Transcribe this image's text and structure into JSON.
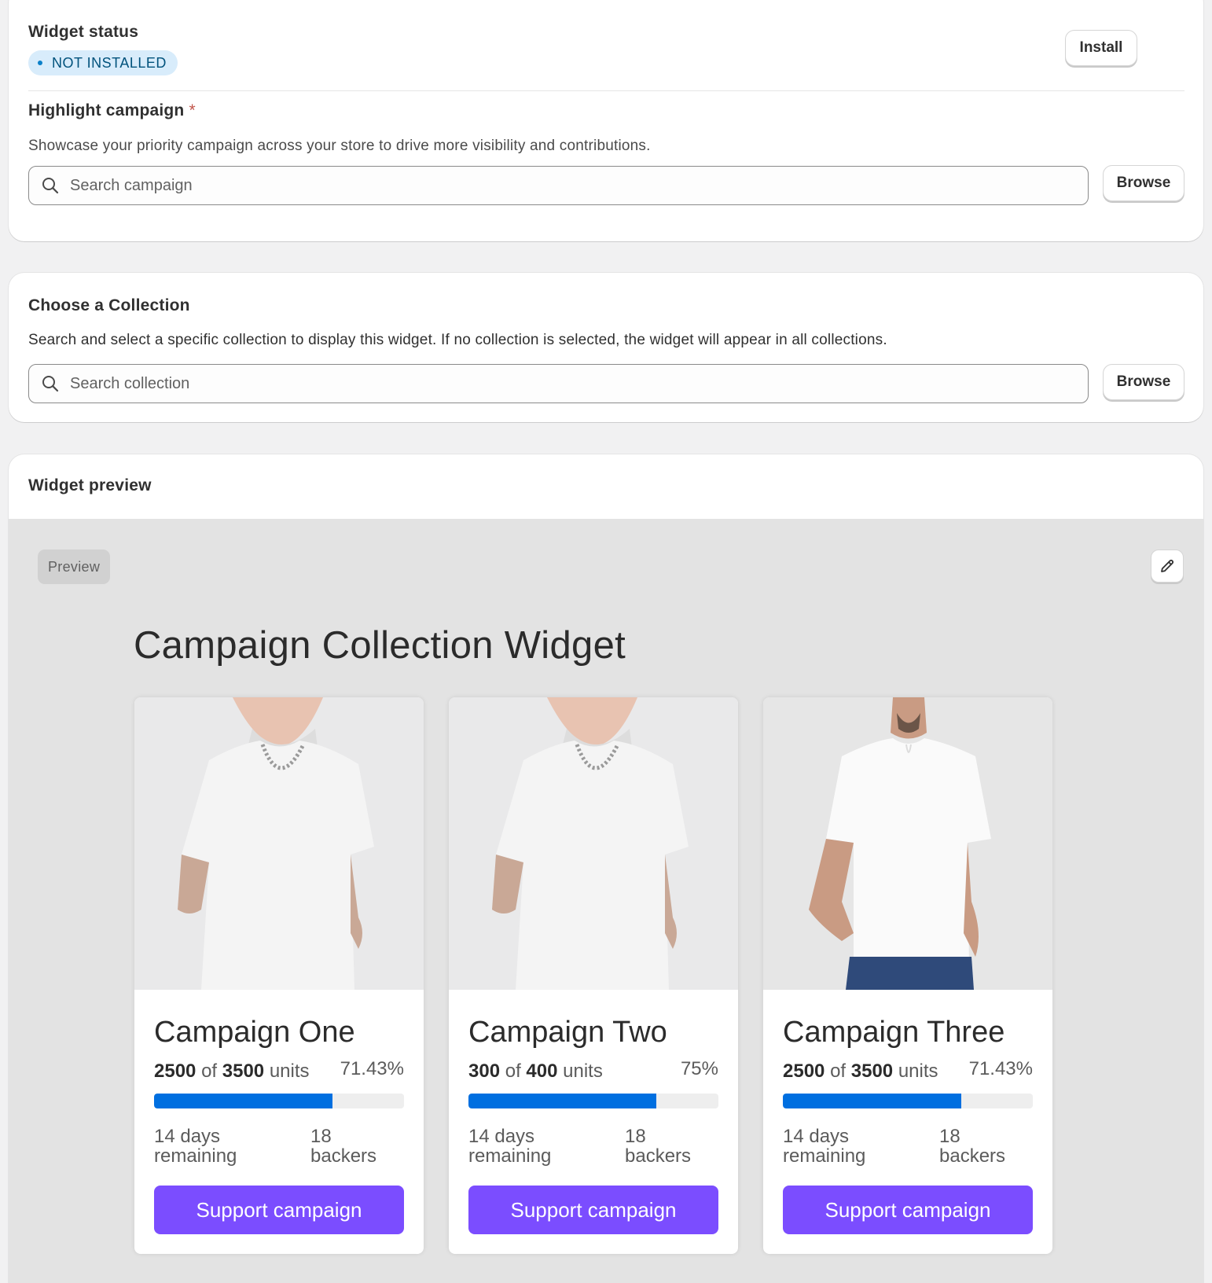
{
  "status": {
    "title": "Widget status",
    "badge": "NOT INSTALLED",
    "install_label": "Install"
  },
  "highlight": {
    "title": "Highlight campaign",
    "required_mark": "*",
    "description": "Showcase your priority campaign across your store to drive more visibility and contributions.",
    "search_placeholder": "Search campaign",
    "search_value": "",
    "browse_label": "Browse"
  },
  "collection": {
    "title": "Choose a Collection",
    "description": "Search and select a specific collection to display this widget. If no collection is selected, the widget will appear in all collections.",
    "search_placeholder": "Search collection",
    "search_value": "",
    "browse_label": "Browse"
  },
  "preview": {
    "title": "Widget preview",
    "tag": "Preview",
    "widget_title": "Campaign Collection Widget",
    "campaigns": [
      {
        "name": "Campaign One",
        "current": "2500",
        "of": "of",
        "goal": "3500",
        "unit": "units",
        "percent": "71.43%",
        "progress": 0.7143,
        "days": "14 days remaining",
        "backers": "18 backers",
        "button": "Support campaign",
        "image": "model-with-necklace-white-tshirt"
      },
      {
        "name": "Campaign Two",
        "current": "300",
        "of": "of",
        "goal": "400",
        "unit": "units",
        "percent": "75%",
        "progress": 0.75,
        "days": "14 days remaining",
        "backers": "18 backers",
        "button": "Support campaign",
        "image": "model-with-necklace-white-tshirt"
      },
      {
        "name": "Campaign Three",
        "current": "2500",
        "of": "of",
        "goal": "3500",
        "unit": "units",
        "percent": "71.43%",
        "progress": 0.7143,
        "days": "14 days remaining",
        "backers": "18 backers",
        "button": "Support campaign",
        "image": "bearded-model-white-tshirt-jeans"
      }
    ]
  },
  "colors": {
    "accent_button": "#7b4dff",
    "progress": "#006fe0",
    "badge_bg": "#d8ecfb",
    "badge_text": "#00527c"
  },
  "icons": {
    "search": "search-icon",
    "edit": "pencil-icon"
  }
}
